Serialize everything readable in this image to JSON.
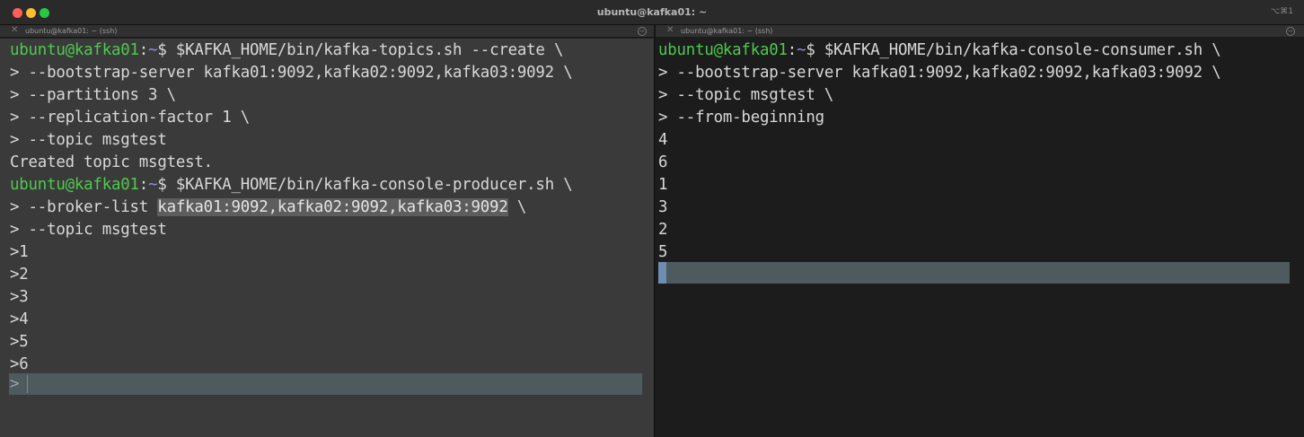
{
  "window": {
    "title": "ubuntu@kafka01: ~",
    "shortcut": "⌥⌘1"
  },
  "tabs": {
    "left": {
      "label": "ubuntu@kafka01: ~ (ssh)"
    },
    "right": {
      "label": "ubuntu@kafka01: ~ (ssh)"
    }
  },
  "prompt": {
    "user_host": "ubuntu@kafka01",
    "separator": ":",
    "path": "~",
    "symbol": "$"
  },
  "left_pane": {
    "cmd1": " $KAFKA_HOME/bin/kafka-topics.sh --create \\",
    "cmd1_cont": [
      "> --bootstrap-server kafka01:9092,kafka02:9092,kafka03:9092 \\",
      "> --partitions 3 \\",
      "> --replication-factor 1 \\",
      "> --topic msgtest"
    ],
    "output": "Created topic msgtest.",
    "cmd2": " $KAFKA_HOME/bin/kafka-console-producer.sh \\",
    "broker_prefix": "> --broker-list ",
    "broker_selected": "kafka01:9092,kafka02:9092,kafka03:9092",
    "broker_suffix": " \\",
    "cmd2_topic": "> --topic msgtest",
    "producer_inputs": [
      ">1",
      ">2",
      ">3",
      ">4",
      ">5",
      ">6"
    ],
    "active_prompt": ">"
  },
  "right_pane": {
    "cmd": " $KAFKA_HOME/bin/kafka-console-consumer.sh \\",
    "cmd_cont": [
      "> --bootstrap-server kafka01:9092,kafka02:9092,kafka03:9092 \\",
      "> --topic msgtest \\",
      "> --from-beginning"
    ],
    "consumed": [
      "4",
      "6",
      "1",
      "3",
      "2",
      "5"
    ]
  },
  "colors": {
    "user_host": "#4ec94e",
    "path": "#8e8ef0",
    "left_bg": "#3a3a3a",
    "right_bg": "#1c1c1c",
    "cursor_row": "#4d5b5f"
  }
}
